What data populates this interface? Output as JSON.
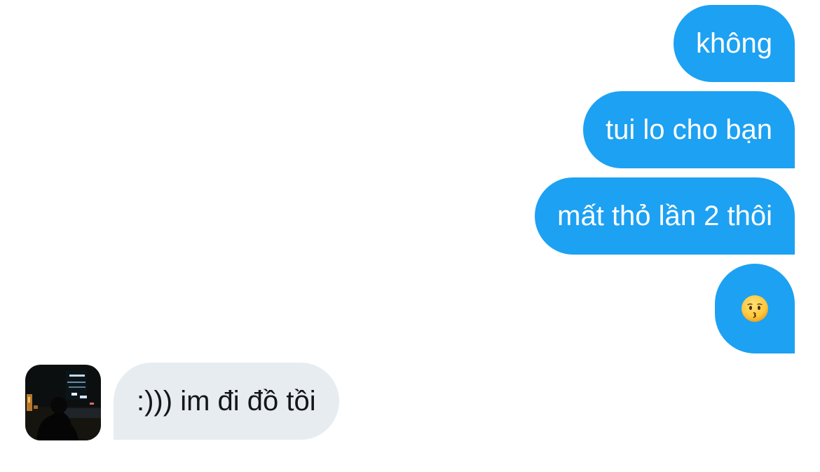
{
  "conversation": {
    "messages": [
      {
        "sender": "me",
        "text": "không"
      },
      {
        "sender": "me",
        "text": "tui lo cho bạn"
      },
      {
        "sender": "me",
        "text": "mất thỏ lần 2 thôi"
      },
      {
        "sender": "me",
        "emoji": "kissing-face"
      },
      {
        "sender": "other",
        "text": ":))) im đi đồ tồi"
      }
    ]
  },
  "colors": {
    "outgoing_bubble": "#1da1f2",
    "outgoing_text": "#ffffff",
    "incoming_bubble": "#e6ecf0",
    "incoming_text": "#14171a"
  }
}
